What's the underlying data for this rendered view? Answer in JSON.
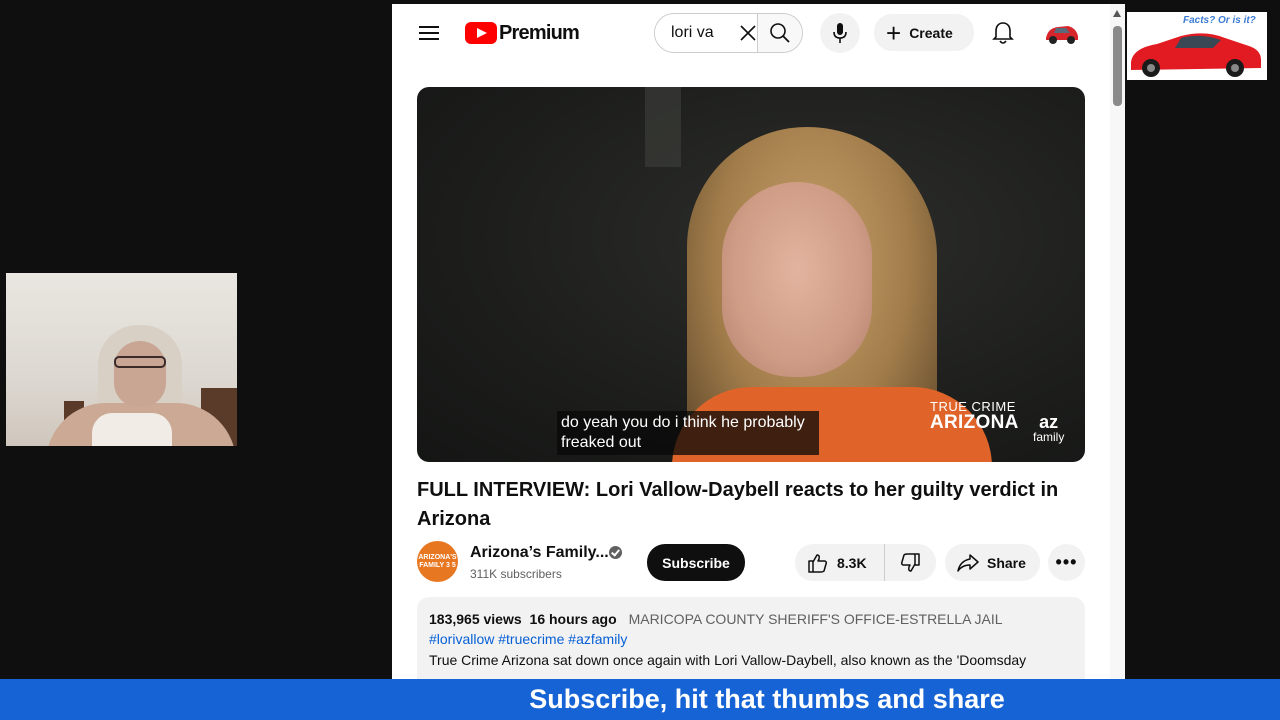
{
  "masthead": {
    "logo_text": "Premium",
    "search_value": "lori va",
    "create_label": "Create"
  },
  "video": {
    "caption_lines": [
      "do yeah you do i think he probably",
      "freaked out"
    ],
    "watermark_line1": "TRUE CRIME",
    "watermark_line2": "ARIZONA",
    "watermark_az": "az",
    "watermark_family": "family",
    "title": "FULL INTERVIEW: Lori Vallow-Daybell reacts to her guilty verdict in Arizona"
  },
  "channel": {
    "avatar_text": "ARIZONA'S FAMILY 3 5",
    "name": "Arizona’s Family...",
    "subscribers": "311K subscribers",
    "subscribe_label": "Subscribe"
  },
  "actions": {
    "like_count": "8.3K",
    "share_label": "Share",
    "more_label": "•••"
  },
  "description": {
    "views": "183,965 views",
    "time": "16 hours ago",
    "location": "MARICOPA COUNTY SHERIFF'S OFFICE-ESTRELLA JAIL",
    "tags": [
      "#lorivallow",
      "#truecrime",
      "#azfamily"
    ],
    "text": "True Crime Arizona sat down once again with Lori Vallow-Daybell, also known as the 'Doomsday"
  },
  "overlay": {
    "thumbnail_tagline": "Facts? Or is it?",
    "banner_text": "Subscribe, hit that thumbs and share"
  },
  "colors": {
    "brand_red": "#ff0000",
    "link_blue": "#065fd4",
    "banner_blue": "#1563d4",
    "channel_orange": "#e87722"
  },
  "icons": [
    "menu-icon",
    "youtube-logo-icon",
    "clear-icon",
    "search-icon",
    "mic-icon",
    "plus-icon",
    "bell-icon",
    "thumbs-up-icon",
    "thumbs-down-icon",
    "share-icon",
    "more-icon",
    "verified-icon"
  ]
}
